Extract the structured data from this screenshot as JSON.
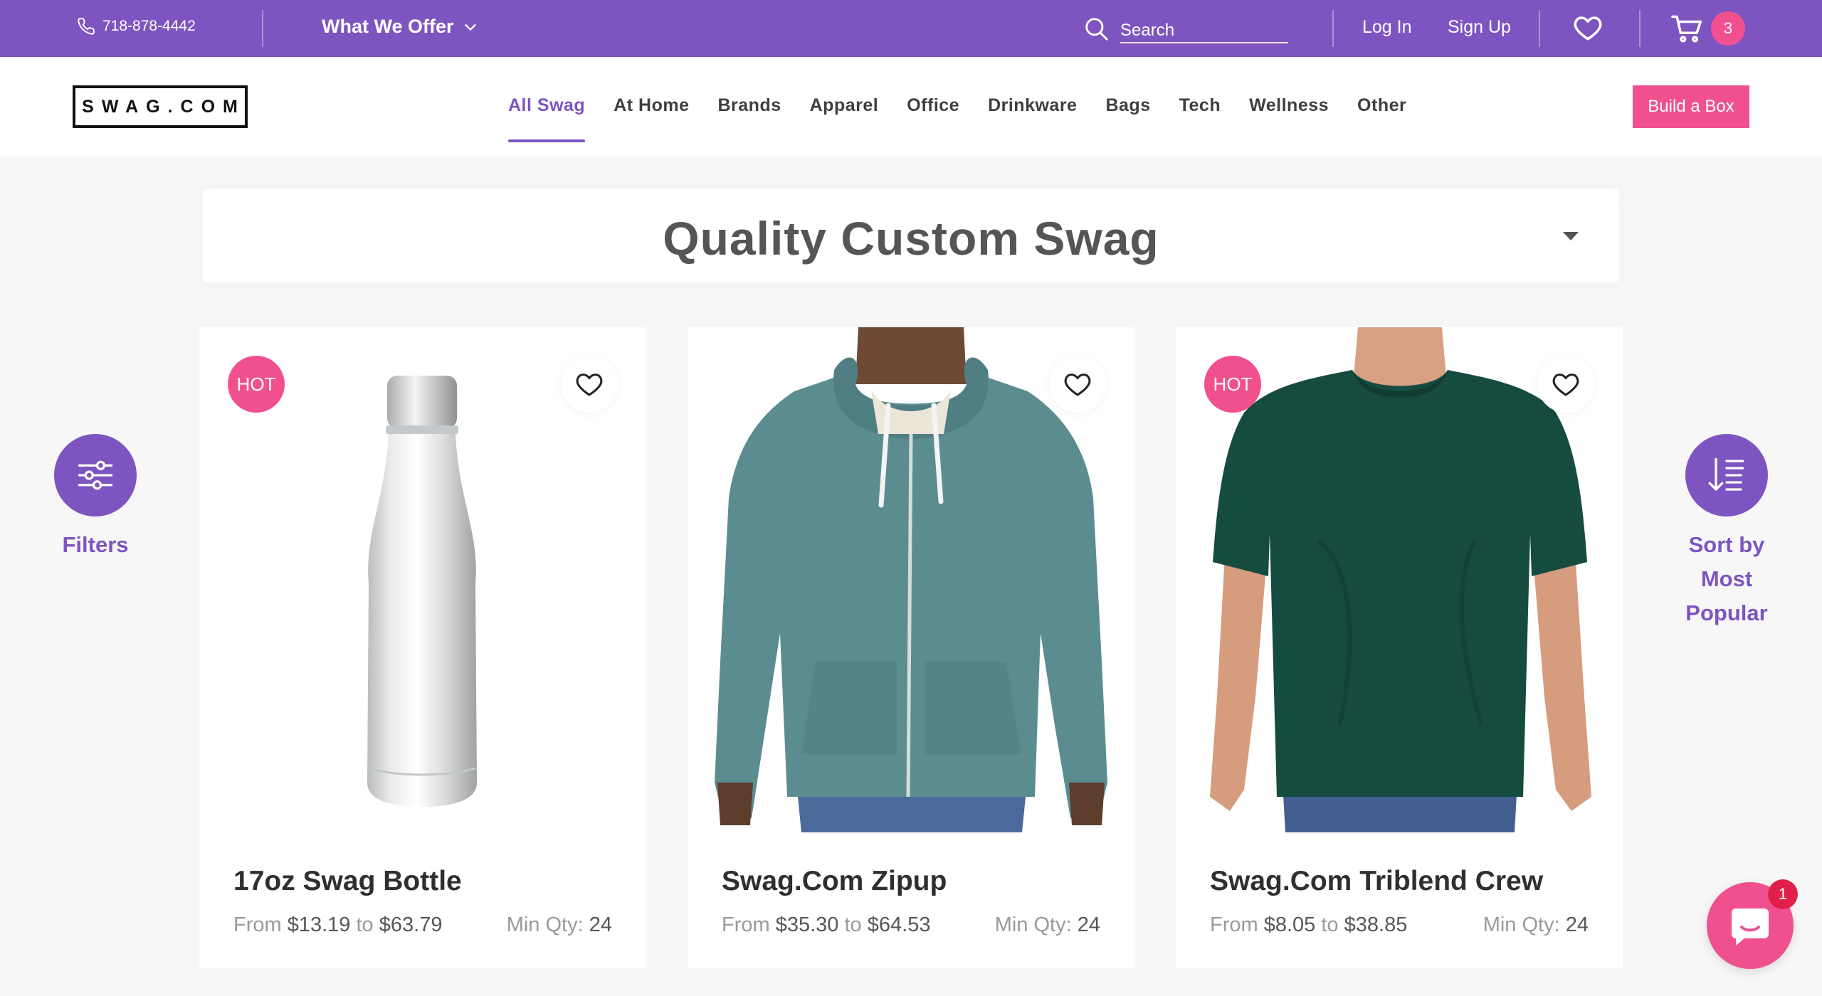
{
  "topbar": {
    "phone": "718-878-4442",
    "offer_label": "What We Offer",
    "search_placeholder": "Search",
    "login_label": "Log In",
    "signup_label": "Sign Up",
    "cart_count": "3"
  },
  "header": {
    "logo_text": "SWAG.COM",
    "nav": [
      "All Swag",
      "At Home",
      "Brands",
      "Apparel",
      "Office",
      "Drinkware",
      "Bags",
      "Tech",
      "Wellness",
      "Other"
    ],
    "active_nav": "All Swag",
    "build_box_label": "Build a Box"
  },
  "main": {
    "title": "Quality Custom Swag",
    "filters_label": "Filters",
    "sort_label_lines": [
      "Sort by",
      "Most",
      "Popular"
    ]
  },
  "products": [
    {
      "name": "17oz Swag Bottle",
      "from_label": "From",
      "price_from": "$13.19",
      "to_label": "to",
      "price_to": "$63.79",
      "min_label": "Min Qty:",
      "min_qty": "24",
      "badge": "HOT",
      "image": "steel-bottle"
    },
    {
      "name": "Swag.Com Zipup",
      "from_label": "From",
      "price_from": "$35.30",
      "to_label": "to",
      "price_to": "$64.53",
      "min_label": "Min Qty:",
      "min_qty": "24",
      "badge": "",
      "image": "teal-zip-hoodie"
    },
    {
      "name": "Swag.Com Triblend Crew",
      "from_label": "From",
      "price_from": "$8.05",
      "to_label": "to",
      "price_to": "$38.85",
      "min_label": "Min Qty:",
      "min_qty": "24",
      "badge": "HOT",
      "image": "dark-green-tee"
    }
  ],
  "chat": {
    "badge_count": "1"
  },
  "colors": {
    "brand_purple": "#7e55c0",
    "accent_pink": "#f1508f",
    "background": "#f7f7f8"
  },
  "icons": [
    "phone-icon",
    "chevron-down-icon",
    "search-icon",
    "heart-icon",
    "cart-icon",
    "filter-icon",
    "sort-icon",
    "chat-icon"
  ]
}
